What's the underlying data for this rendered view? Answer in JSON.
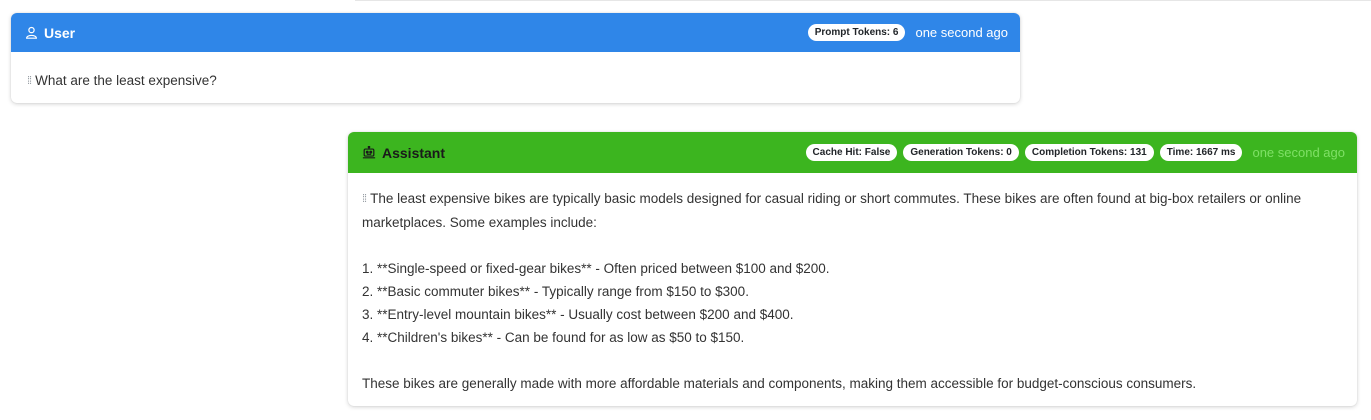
{
  "user_message": {
    "role_label": "User",
    "icon": "user-icon",
    "color": "#2f86e8",
    "badges": {
      "prompt_tokens": "Prompt Tokens: 6"
    },
    "timestamp": "one second ago",
    "text": "What are the least expensive?"
  },
  "assistant_message": {
    "role_label": "Assistant",
    "icon": "robot-icon",
    "color": "#3cb51f",
    "badges": {
      "cache_hit": "Cache Hit: False",
      "generation_tokens": "Generation Tokens: 0",
      "completion_tokens": "Completion Tokens: 131",
      "time": "Time: 1667 ms"
    },
    "timestamp": "one second ago",
    "intro": "The least expensive bikes are typically basic models designed for casual riding or short commutes. These bikes are often found at big-box retailers or online marketplaces. Some examples include:",
    "list": [
      "1. **Single-speed or fixed-gear bikes** - Often priced between $100 and $200.",
      "2. **Basic commuter bikes** - Typically range from $150 to $300.",
      "3. **Entry-level mountain bikes** - Usually cost between $200 and $400.",
      "4. **Children's bikes** - Can be found for as low as $50 to $150."
    ],
    "outro": "These bikes are generally made with more affordable materials and components, making them accessible for budget-conscious consumers."
  }
}
